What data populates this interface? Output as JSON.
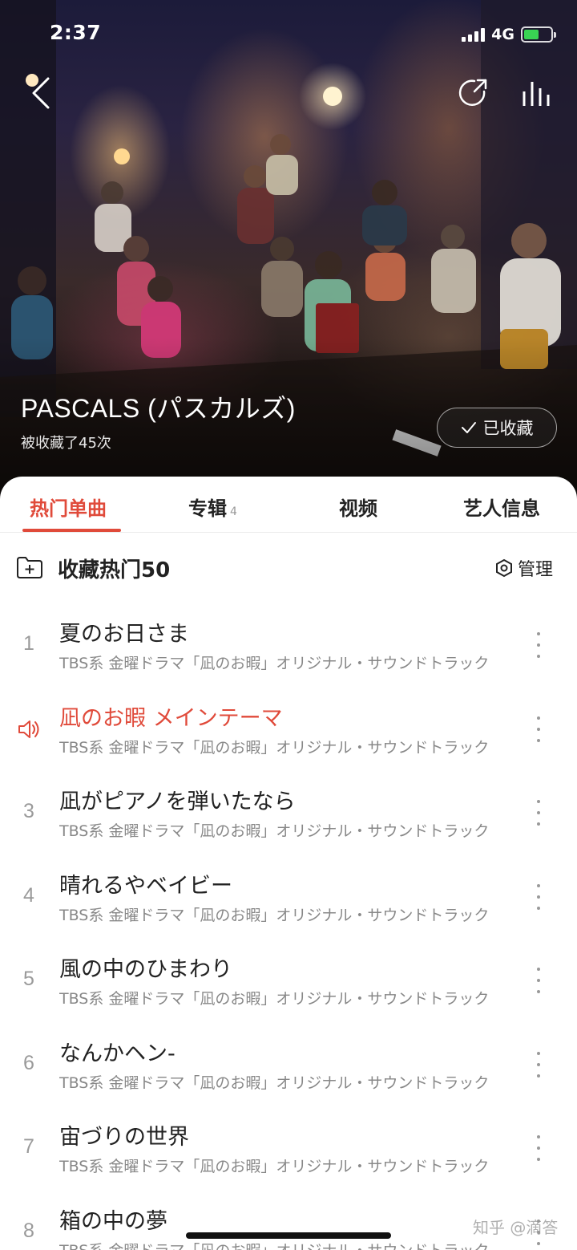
{
  "status_bar": {
    "time": "2:37",
    "network": "4G"
  },
  "header": {
    "back_icon": "chevron-left-icon",
    "share_icon": "share-icon",
    "now_playing_icon": "equalizer-icon"
  },
  "artist": {
    "name": "PASCALS (パスカルズ)",
    "favorited_count": "被收藏了45次",
    "favorite_button_label": "已收藏"
  },
  "tabs": [
    {
      "label": "热门单曲",
      "count": ""
    },
    {
      "label": "专辑",
      "count": "4"
    },
    {
      "label": "视频",
      "count": ""
    },
    {
      "label": "艺人信息",
      "count": ""
    }
  ],
  "active_tab": 0,
  "collection": {
    "title": "收藏热门50",
    "manage_label": "管理"
  },
  "songs": [
    {
      "index": "1",
      "title": "夏のお日さま",
      "album": "TBS系 金曜ドラマ「凪のお暇」オリジナル・サウンドトラック",
      "playing": false
    },
    {
      "index": "2",
      "title": "凪のお暇 メインテーマ",
      "album": "TBS系 金曜ドラマ「凪のお暇」オリジナル・サウンドトラック",
      "playing": true
    },
    {
      "index": "3",
      "title": "凪がピアノを弾いたなら",
      "album": "TBS系 金曜ドラマ「凪のお暇」オリジナル・サウンドトラック",
      "playing": false
    },
    {
      "index": "4",
      "title": "晴れるやベイビー",
      "album": "TBS系 金曜ドラマ「凪のお暇」オリジナル・サウンドトラック",
      "playing": false
    },
    {
      "index": "5",
      "title": "風の中のひまわり",
      "album": "TBS系 金曜ドラマ「凪のお暇」オリジナル・サウンドトラック",
      "playing": false
    },
    {
      "index": "6",
      "title": "なんかヘン-",
      "album": "TBS系 金曜ドラマ「凪のお暇」オリジナル・サウンドトラック",
      "playing": false
    },
    {
      "index": "7",
      "title": "宙づりの世界",
      "album": "TBS系 金曜ドラマ「凪のお暇」オリジナル・サウンドトラック",
      "playing": false
    },
    {
      "index": "8",
      "title": "箱の中の夢",
      "album": "TBS系 金曜ドラマ「凪のお暇」オリジナル・サウンドトラック",
      "playing": false
    }
  ],
  "watermark": "知乎 @滴答",
  "colors": {
    "accent": "#e04a3a",
    "battery": "#39d353"
  }
}
